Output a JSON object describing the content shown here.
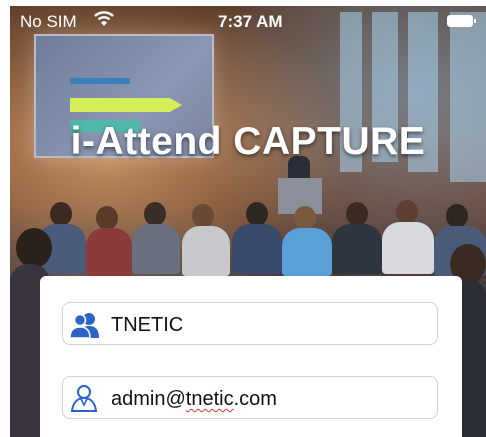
{
  "status_bar": {
    "carrier": "No SIM",
    "time": "7:37 AM",
    "wifi_icon": "wifi-icon",
    "battery_icon": "battery-icon"
  },
  "app": {
    "title": "i-Attend CAPTURE"
  },
  "login": {
    "organization_value": "TNETIC",
    "organization_icon": "group-icon",
    "username_value_prefix": "admin@",
    "username_value_misspelled": "tnetic",
    "username_value_suffix": ".com",
    "username_icon": "user-icon"
  },
  "colors": {
    "icon_blue": "#2b63c9",
    "field_border": "#cfd2d8",
    "spellcheck_red": "#e0302a"
  }
}
